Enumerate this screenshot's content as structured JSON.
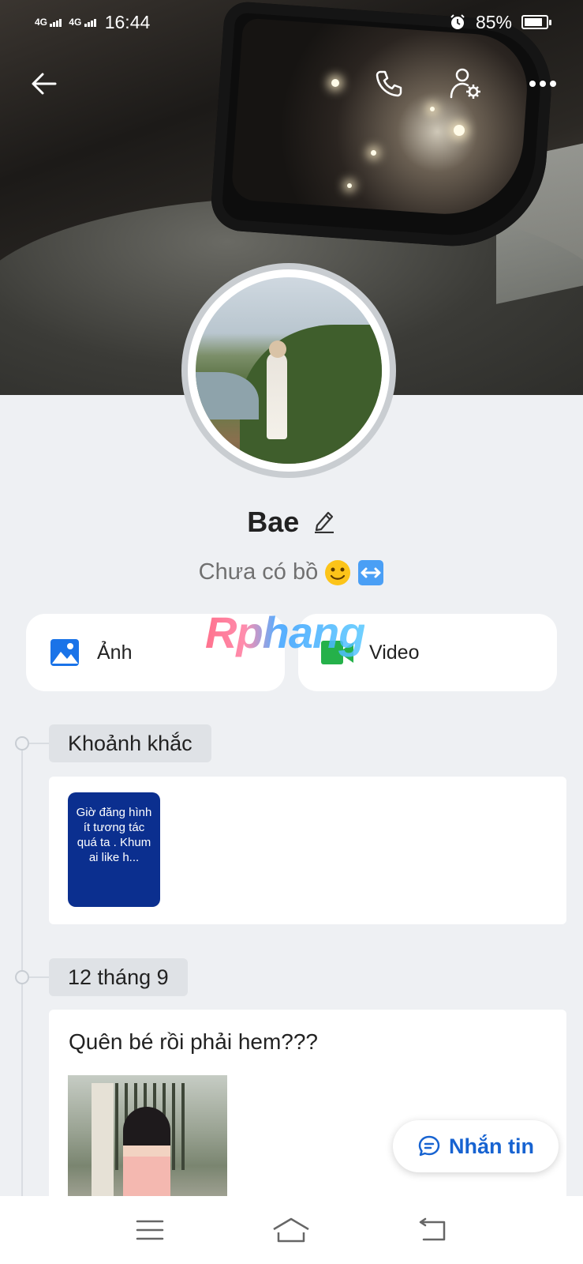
{
  "status_bar": {
    "network_1": "4G",
    "network_2": "4G",
    "time": "16:44",
    "battery_text": "85%",
    "battery_level": 0.85
  },
  "profile": {
    "name": "Bae",
    "bio": "Chưa có bồ",
    "bio_emojis": [
      "slightly-smiling-face-emoji",
      "left-right-arrow-emoji"
    ]
  },
  "media": {
    "photos_label": "Ảnh",
    "videos_label": "Video"
  },
  "watermark": "Rphang",
  "timeline": {
    "moments_label": "Khoảnh khắc",
    "story_text": "Giờ đăng hình ít tương tác quá ta . Khum ai like h...",
    "date_label": "12 tháng 9",
    "post_text": "Quên bé rồi phải hem???"
  },
  "message_button": {
    "label": "Nhắn tin"
  },
  "icons": {
    "back": "back-arrow-icon",
    "call": "phone-icon",
    "profile_settings": "user-settings-icon",
    "more": "more-dots-icon",
    "edit": "pencil-icon",
    "photos": "image-icon",
    "videos": "video-camera-icon",
    "message": "chat-bubble-icon",
    "nav_menu": "menu-icon",
    "nav_home": "home-icon",
    "nav_back": "return-icon"
  },
  "colors": {
    "accent": "#1763d1",
    "story_bg": "#0b2f8f",
    "video_icon": "#25b14a",
    "image_icon": "#1a73e8",
    "page_bg": "#eef0f3"
  }
}
